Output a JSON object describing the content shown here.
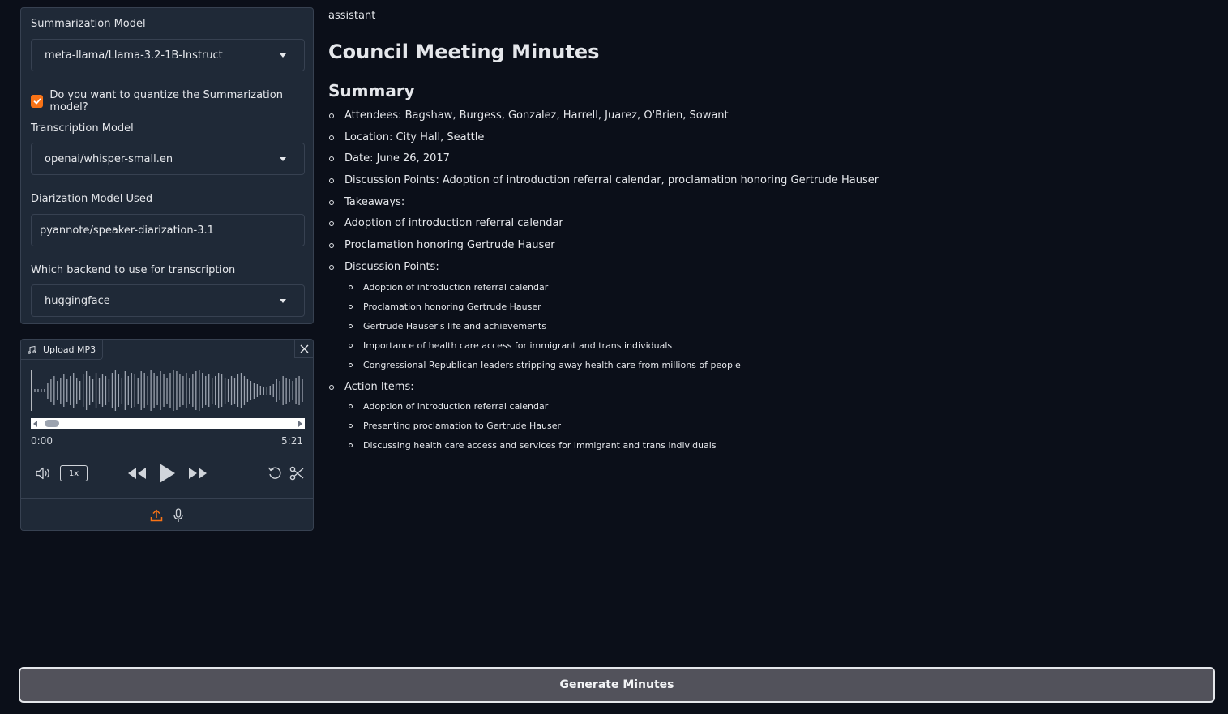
{
  "settings": {
    "summarization_model_label": "Summarization Model",
    "summarization_model_value": "meta-llama/Llama-3.2-1B-Instruct",
    "quantize_label": "Do you want to quantize the Summarization model?",
    "quantize_checked": true,
    "transcription_model_label": "Transcription Model",
    "transcription_model_value": "openai/whisper-small.en",
    "diarization_label": "Diarization Model Used",
    "diarization_value": "pyannote/speaker-diarization-3.1",
    "backend_label": "Which backend to use for transcription",
    "backend_value": "huggingface"
  },
  "audio": {
    "tab_label": "Upload MP3",
    "current_time": "0:00",
    "duration": "5:21",
    "speed": "1x"
  },
  "output": {
    "role": "assistant",
    "title": "Council Meeting Minutes",
    "summary_heading": "Summary",
    "items": [
      "Attendees: Bagshaw, Burgess, Gonzalez, Harrell, Juarez, O'Brien, Sowant",
      "Location: City Hall, Seattle",
      "Date: June 26, 2017",
      "Discussion Points: Adoption of introduction referral calendar, proclamation honoring Gertrude Hauser",
      "Takeaways:",
      "Adoption of introduction referral calendar",
      "Proclamation honoring Gertrude Hauser",
      "Discussion Points:"
    ],
    "discussion_points": [
      "Adoption of introduction referral calendar",
      "Proclamation honoring Gertrude Hauser",
      "Gertrude Hauser's life and achievements",
      "Importance of health care access for immigrant and trans individuals",
      "Congressional Republican leaders stripping away health care from millions of people"
    ],
    "action_items_label": "Action Items:",
    "action_items": [
      "Adoption of introduction referral calendar",
      "Presenting proclamation to Gertrude Hauser",
      "Discussing health care access and services for immigrant and trans individuals"
    ]
  },
  "generate_button_label": "Generate Minutes",
  "colors": {
    "accent": "#f97316",
    "background": "#0b0f19",
    "panel": "#1f2937",
    "border": "#374151"
  }
}
